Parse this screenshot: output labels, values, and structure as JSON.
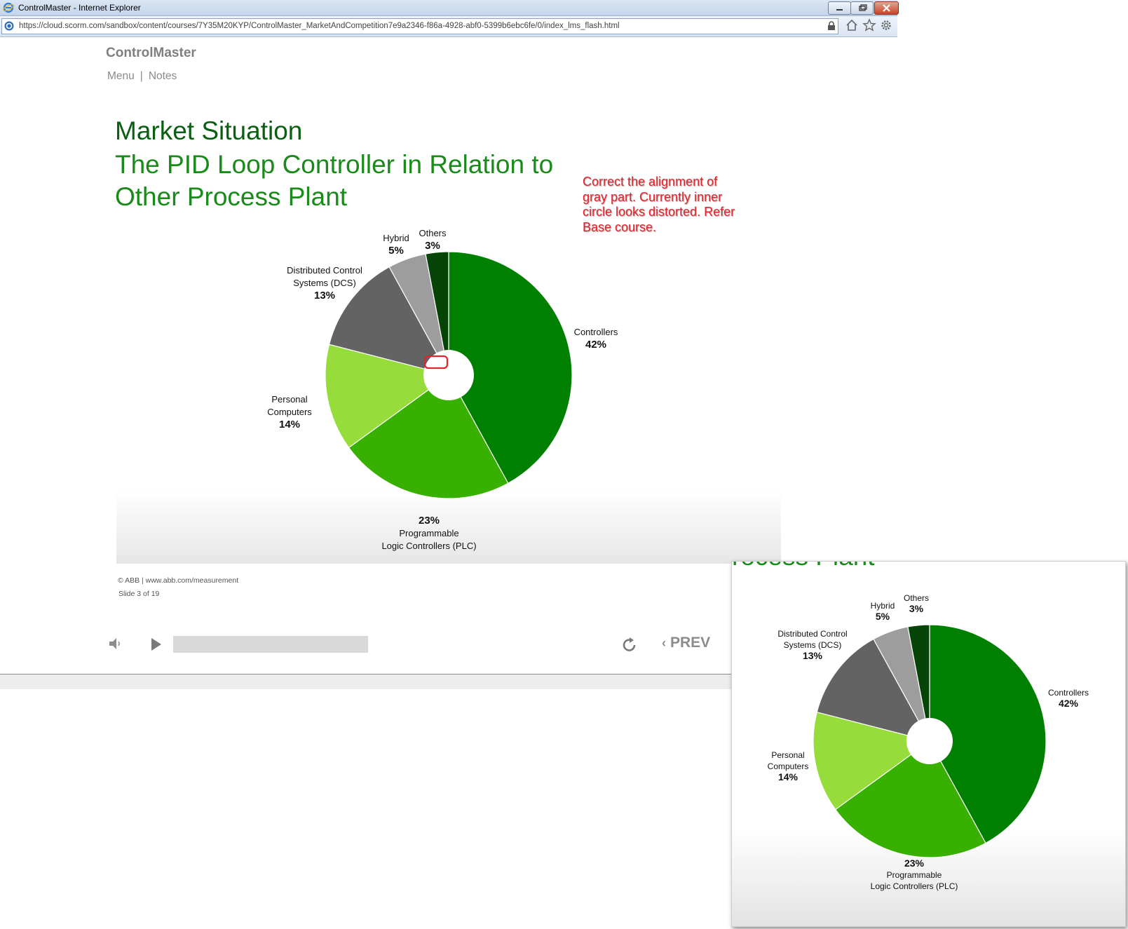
{
  "browser": {
    "window_title": "ControlMaster - Internet Explorer",
    "url": "https://cloud.scorm.com/sandbox/content/courses/7Y35M20KYP/ControlMaster_MarketAndCompetition7e9a2346-f86a-4928-abf0-5399b6ebc6fe/0/index_lms_flash.html"
  },
  "header": {
    "brand": "ControlMaster",
    "menu_label": "Menu",
    "separator": "|",
    "notes_label": "Notes"
  },
  "slide": {
    "title": "Market Situation",
    "subtitle": "The PID Loop Controller in Relation to Other Process Plant",
    "review_note": "Correct the alignment of gray part. Currently inner circle looks distorted. Refer Base course.",
    "footer_copyright": "© ABB | www.abb.com/measurement",
    "slide_counter": "Slide 3 of 19"
  },
  "player": {
    "prev_label": "PREV",
    "prev_chevron": "‹"
  },
  "overlay": {
    "ghost_title": "rocess Plant"
  },
  "chart_data": [
    {
      "type": "pie",
      "slices": [
        {
          "label": [
            "Controllers"
          ],
          "value": 42,
          "value_label": "42%",
          "color": "#008000"
        },
        {
          "label": [
            "Programmable",
            "Logic Controllers (PLC)"
          ],
          "value": 23,
          "value_label": "23%",
          "color": "#38b000"
        },
        {
          "label": [
            "Personal",
            "Computers"
          ],
          "value": 14,
          "value_label": "14%",
          "color": "#96dc3a"
        },
        {
          "label": [
            "Distributed Control",
            "Systems (DCS)"
          ],
          "value": 13,
          "value_label": "13%",
          "color": "#636363"
        },
        {
          "label": [
            "Hybrid"
          ],
          "value": 5,
          "value_label": "5%",
          "color": "#9d9d9d"
        },
        {
          "label": [
            "Others"
          ],
          "value": 3,
          "value_label": "3%",
          "color": "#074407"
        }
      ]
    },
    {
      "type": "pie",
      "slices": [
        {
          "label": [
            "Controllers"
          ],
          "value": 42,
          "value_label": "42%",
          "color": "#008000"
        },
        {
          "label": [
            "Programmable",
            "Logic Controllers (PLC)"
          ],
          "value": 23,
          "value_label": "23%",
          "color": "#38b000"
        },
        {
          "label": [
            "Personal",
            "Computers"
          ],
          "value": 14,
          "value_label": "14%",
          "color": "#96dc3a"
        },
        {
          "label": [
            "Distributed Control",
            "Systems (DCS)"
          ],
          "value": 13,
          "value_label": "13%",
          "color": "#636363"
        },
        {
          "label": [
            "Hybrid"
          ],
          "value": 5,
          "value_label": "5%",
          "color": "#9d9d9d"
        },
        {
          "label": [
            "Others"
          ],
          "value": 3,
          "value_label": "3%",
          "color": "#074407"
        }
      ]
    }
  ]
}
